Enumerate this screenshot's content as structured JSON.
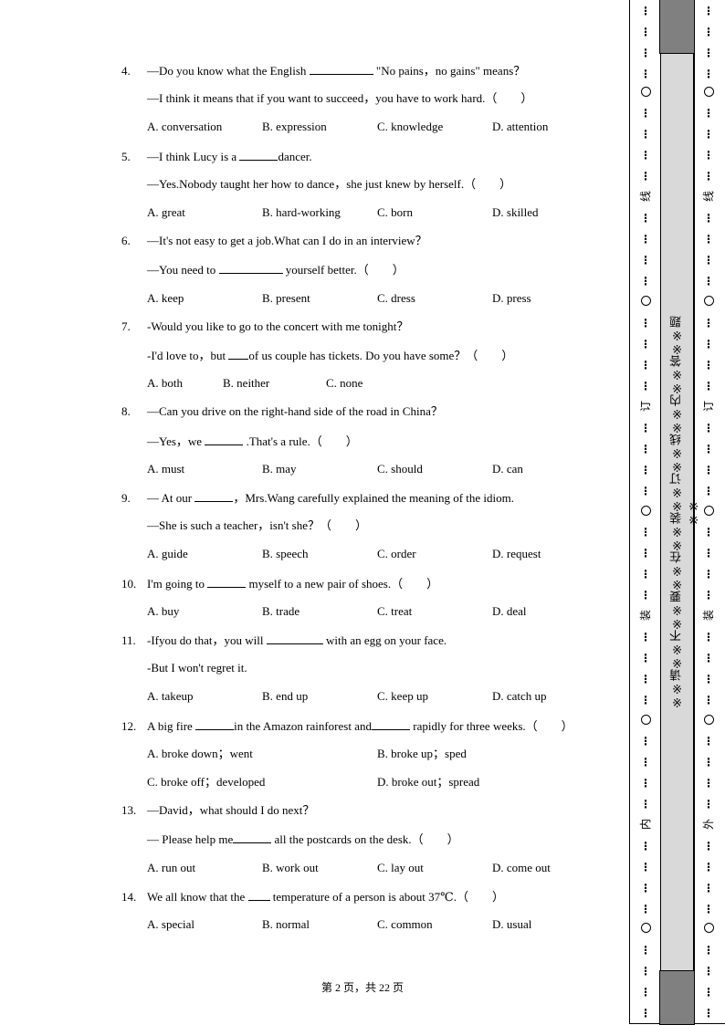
{
  "questions": [
    {
      "number": "4.",
      "lines": [
        "—Do you know what the English",
        "\"No pains，no gains\" means？",
        "—I think it means that if you want to succeed，you have to work hard.（　　）"
      ],
      "options": [
        "A. conversation",
        "B. expression",
        "C. knowledge",
        "D. attention"
      ]
    },
    {
      "number": "5.",
      "lines": [
        "—I think Lucy is a",
        "dancer.",
        "—Yes.Nobody taught her how to dance，she just knew by herself.（　　）"
      ],
      "options": [
        "A. great",
        "B. hard-working",
        "C. born",
        "D. skilled"
      ]
    },
    {
      "number": "6.",
      "lines": [
        "—It's not easy to get a job.What can I do in an interview？",
        "—You need to",
        "yourself better.（　　）"
      ],
      "options": [
        "A. keep",
        "B. present",
        "C. dress",
        "D. press"
      ]
    },
    {
      "number": "7.",
      "lines": [
        "-Would you like to go to the concert with me tonight？",
        "-I'd love to，but",
        "of us couple has tickets. Do you have some？（　　）"
      ],
      "options": [
        "A. both",
        "B. neither",
        "C. none"
      ]
    },
    {
      "number": "8.",
      "lines": [
        "—Can you drive on the right-hand side of the road in China？",
        "—Yes，we",
        ".That's a rule.（　　）"
      ],
      "options": [
        "A. must",
        "B. may",
        "C. should",
        "D. can"
      ]
    },
    {
      "number": "9.",
      "lines": [
        "— At our",
        "，Mrs.Wang carefully explained the meaning of the idiom.",
        "—She is such a teacher，isn't she？（　　）"
      ],
      "options": [
        "A. guide",
        "B. speech",
        "C. order",
        "D. request"
      ]
    },
    {
      "number": "10.",
      "lines": [
        "I'm going to",
        "myself to a new pair of shoes.（　　）"
      ],
      "options": [
        "A. buy",
        "B. trade",
        "C. treat",
        "D. deal"
      ]
    },
    {
      "number": "11.",
      "lines": [
        "-Ifyou do that，you will",
        "with an egg on your face.",
        "-But I won't regret it."
      ],
      "options": [
        "A. takeup",
        "B. end up",
        "C. keep up",
        "D. catch up"
      ]
    },
    {
      "number": "12.",
      "lines": [
        "A big fire",
        "in the Amazon rainforest and",
        "rapidly for three weeks.（　　）"
      ],
      "options": [
        "A. broke down；went",
        "B. broke up；sped",
        "C. broke off；developed",
        "D. broke out；spread"
      ]
    },
    {
      "number": "13.",
      "lines": [
        "—David，what should I do next？",
        "— Please help me",
        "all the postcards on the desk.（　　）"
      ],
      "options": [
        "A. run out",
        "B. work out",
        "C. lay out",
        "D. come out"
      ]
    },
    {
      "number": "14.",
      "lines": [
        "We all know that the",
        "temperature of a person is about 37℃.（　　）"
      ],
      "options": [
        "A. special",
        "B. normal",
        "C. common",
        "D. usual"
      ]
    }
  ],
  "footer": "第 2 页，共 22 页",
  "binding": {
    "left_labels": [
      "线",
      "订",
      "装",
      "内"
    ],
    "right_labels": [
      "线",
      "订",
      "装",
      "外"
    ],
    "center_text": "※※请※※不※※要※※在※※装※※订※※线※※内※※答※※题※※",
    "dots": "⋮",
    "circle_symbol": "○"
  }
}
